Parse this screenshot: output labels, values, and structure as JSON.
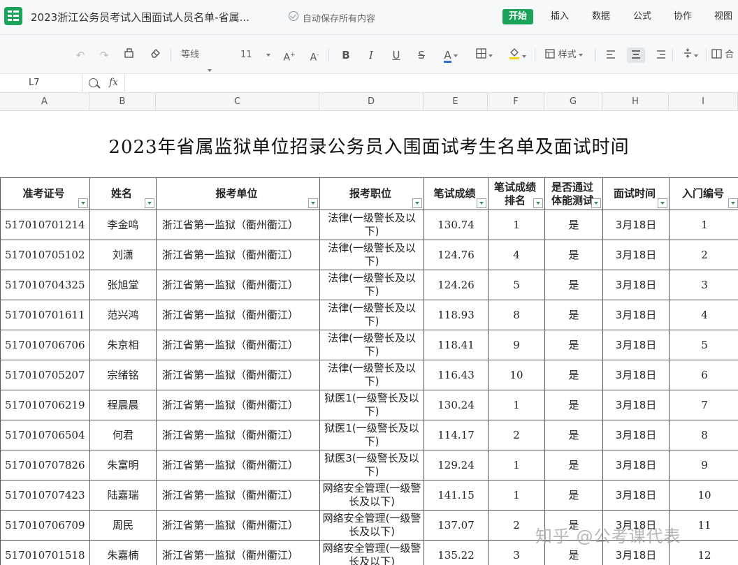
{
  "titlebar": {
    "doc_title": "2023浙江公务员考试入围面试人员名单-省属...",
    "save_status": "自动保存所有内容",
    "tabs": [
      "开始",
      "插入",
      "数据",
      "公式",
      "协作",
      "视图"
    ],
    "active_tab": "开始",
    "accent_color": "#1aa35a"
  },
  "toolbar": {
    "undo_icon": "undo-icon",
    "redo_icon": "redo-icon",
    "font_name": "等线",
    "font_size": "11",
    "style_label": "样式",
    "merge_label": "合"
  },
  "formula_bar": {
    "cell_ref": "L7",
    "fx_label": "fx",
    "value": ""
  },
  "column_letters": [
    "A",
    "B",
    "C",
    "D",
    "E",
    "F",
    "G",
    "H",
    "I"
  ],
  "sheet": {
    "title": "2023年省属监狱单位招录公务员入围面试考生名单及面试时间",
    "headers": [
      "准考证号",
      "姓名",
      "报考单位",
      "报考职位",
      "笔试成绩",
      "笔试成绩排名",
      "是否通过体能测试",
      "面试时间",
      "入门编号"
    ],
    "header_display": [
      "准考证号",
      "姓名",
      "报考单位",
      "报考职位",
      "笔试成绩",
      "笔试成绩\n排名",
      "是否通过\n体能测试",
      "面试时间",
      "入门编号"
    ],
    "rows": [
      [
        "517010701214",
        "李金鸣",
        "浙江省第一监狱（衢州衢江）",
        "法律(一级警长及以下)",
        "130.74",
        "1",
        "是",
        "3月18日",
        "1"
      ],
      [
        "517010705102",
        "刘潇",
        "浙江省第一监狱（衢州衢江）",
        "法律(一级警长及以下)",
        "124.76",
        "4",
        "是",
        "3月18日",
        "2"
      ],
      [
        "517010704325",
        "张旭堂",
        "浙江省第一监狱（衢州衢江）",
        "法律(一级警长及以下)",
        "124.26",
        "5",
        "是",
        "3月18日",
        "3"
      ],
      [
        "517010701611",
        "范兴鸿",
        "浙江省第一监狱（衢州衢江）",
        "法律(一级警长及以下)",
        "118.93",
        "8",
        "是",
        "3月18日",
        "4"
      ],
      [
        "517010706706",
        "朱京相",
        "浙江省第一监狱（衢州衢江）",
        "法律(一级警长及以下)",
        "118.41",
        "9",
        "是",
        "3月18日",
        "5"
      ],
      [
        "517010705207",
        "宗绪铭",
        "浙江省第一监狱（衢州衢江）",
        "法律(一级警长及以下)",
        "116.43",
        "10",
        "是",
        "3月18日",
        "6"
      ],
      [
        "517010706219",
        "程晨晨",
        "浙江省第一监狱（衢州衢江）",
        "狱医1(一级警长及以下)",
        "130.24",
        "1",
        "是",
        "3月18日",
        "7"
      ],
      [
        "517010706504",
        "何君",
        "浙江省第一监狱（衢州衢江）",
        "狱医1(一级警长及以下)",
        "114.17",
        "2",
        "是",
        "3月18日",
        "8"
      ],
      [
        "517010707826",
        "朱富明",
        "浙江省第一监狱（衢州衢江）",
        "狱医3(一级警长及以下)",
        "129.24",
        "1",
        "是",
        "3月18日",
        "9"
      ],
      [
        "517010707423",
        "陆嘉瑞",
        "浙江省第一监狱（衢州衢江）",
        "网络安全管理(一级警长及以下)",
        "141.15",
        "1",
        "是",
        "3月18日",
        "10"
      ],
      [
        "517010706709",
        "周民",
        "浙江省第一监狱（衢州衢江）",
        "网络安全管理(一级警长及以下)",
        "137.07",
        "2",
        "是",
        "3月18日",
        "11"
      ],
      [
        "517010701518",
        "朱嘉楠",
        "浙江省第一监狱（衢州衢江）",
        "网络安全管理(一级警长及以下)",
        "135.22",
        "3",
        "是",
        "3月18日",
        "12"
      ]
    ]
  },
  "watermark": "知乎 @公考课代表"
}
